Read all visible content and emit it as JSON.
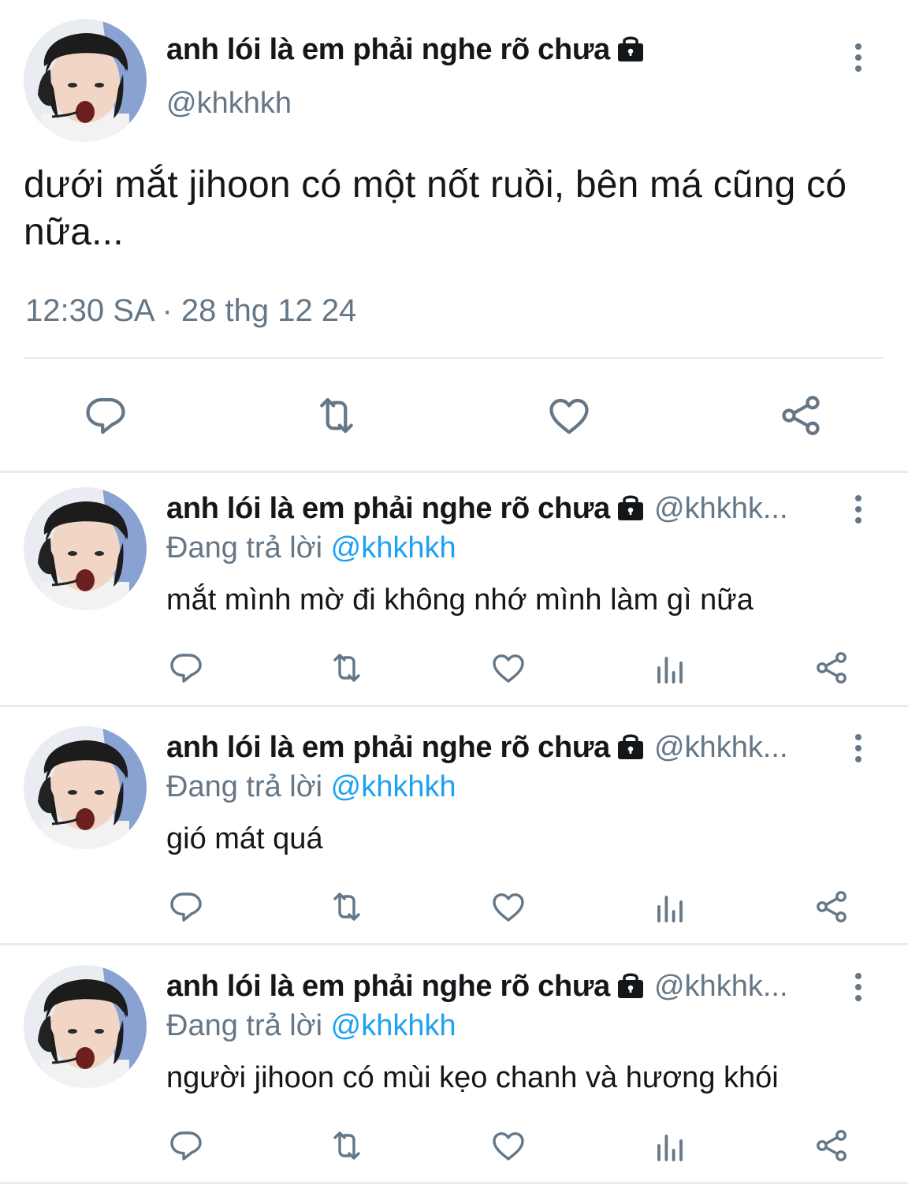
{
  "main_tweet": {
    "display_name": "anh lói là em phải nghe rõ chưa",
    "handle": "@khkhkh",
    "text": "dưới mắt jihoon có một nốt ruồi, bên má cũng có nữa...",
    "timestamp": "12:30 SA · 28 thg 12 24",
    "icons": [
      "reply-icon",
      "retweet-icon",
      "like-icon",
      "share-icon"
    ]
  },
  "replies": [
    {
      "display_name": "anh lói là em phải nghe rõ chưa",
      "handle": "@khkhk...",
      "replying_prefix": "Đang trả lời ",
      "replying_to": "@khkhkh",
      "text": "mắt mình mờ đi không nhớ mình làm gì nữa"
    },
    {
      "display_name": "anh lói là em phải nghe rõ chưa",
      "handle": "@khkhk...",
      "replying_prefix": "Đang trả lời ",
      "replying_to": "@khkhkh",
      "text": "gió mát quá"
    },
    {
      "display_name": "anh lói là em phải nghe rõ chưa",
      "handle": "@khkhk...",
      "replying_prefix": "Đang trả lời ",
      "replying_to": "@khkhkh",
      "text": "người jihoon có mùi kẹo chanh và hương khói"
    }
  ],
  "colors": {
    "text": "#14171a",
    "secondary": "#657786",
    "link": "#1da1f2",
    "divider": "#e6ecf0"
  }
}
